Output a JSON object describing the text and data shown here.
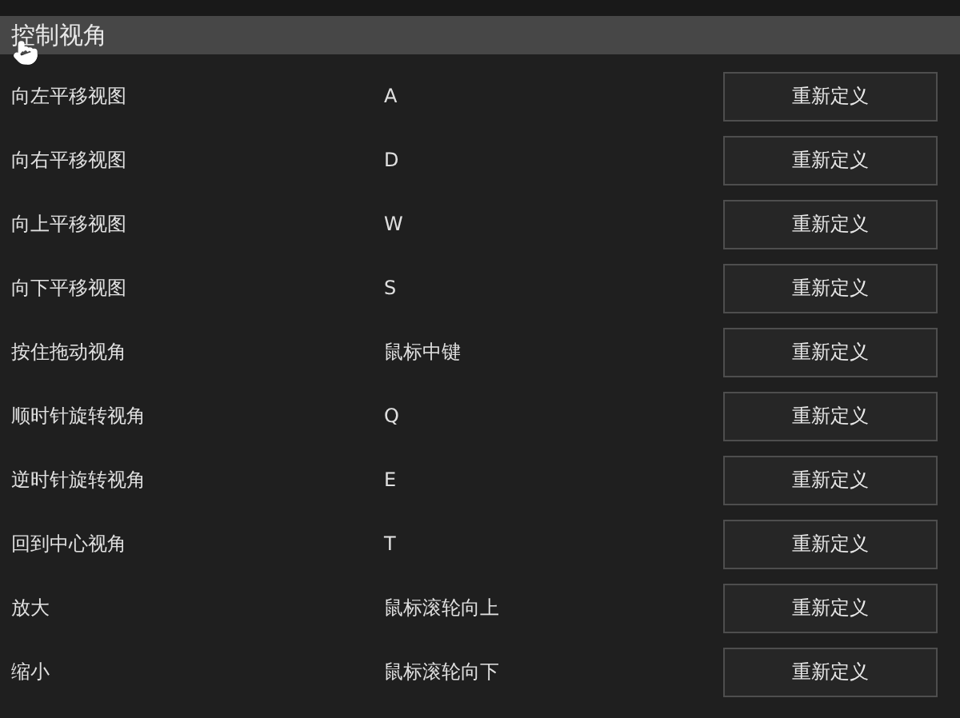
{
  "section": {
    "title": "控制视角"
  },
  "bindings": [
    {
      "action": "向左平移视图",
      "key": "A",
      "button": "重新定义"
    },
    {
      "action": "向右平移视图",
      "key": "D",
      "button": "重新定义"
    },
    {
      "action": "向上平移视图",
      "key": "W",
      "button": "重新定义"
    },
    {
      "action": "向下平移视图",
      "key": "S",
      "button": "重新定义"
    },
    {
      "action": "按住拖动视角",
      "key": "鼠标中键",
      "button": "重新定义"
    },
    {
      "action": "顺时针旋转视角",
      "key": "Q",
      "button": "重新定义"
    },
    {
      "action": "逆时针旋转视角",
      "key": "E",
      "button": "重新定义"
    },
    {
      "action": "回到中心视角",
      "key": "T",
      "button": "重新定义"
    },
    {
      "action": "放大",
      "key": "鼠标滚轮向上",
      "button": "重新定义"
    },
    {
      "action": "缩小",
      "key": "鼠标滚轮向下",
      "button": "重新定义"
    }
  ]
}
